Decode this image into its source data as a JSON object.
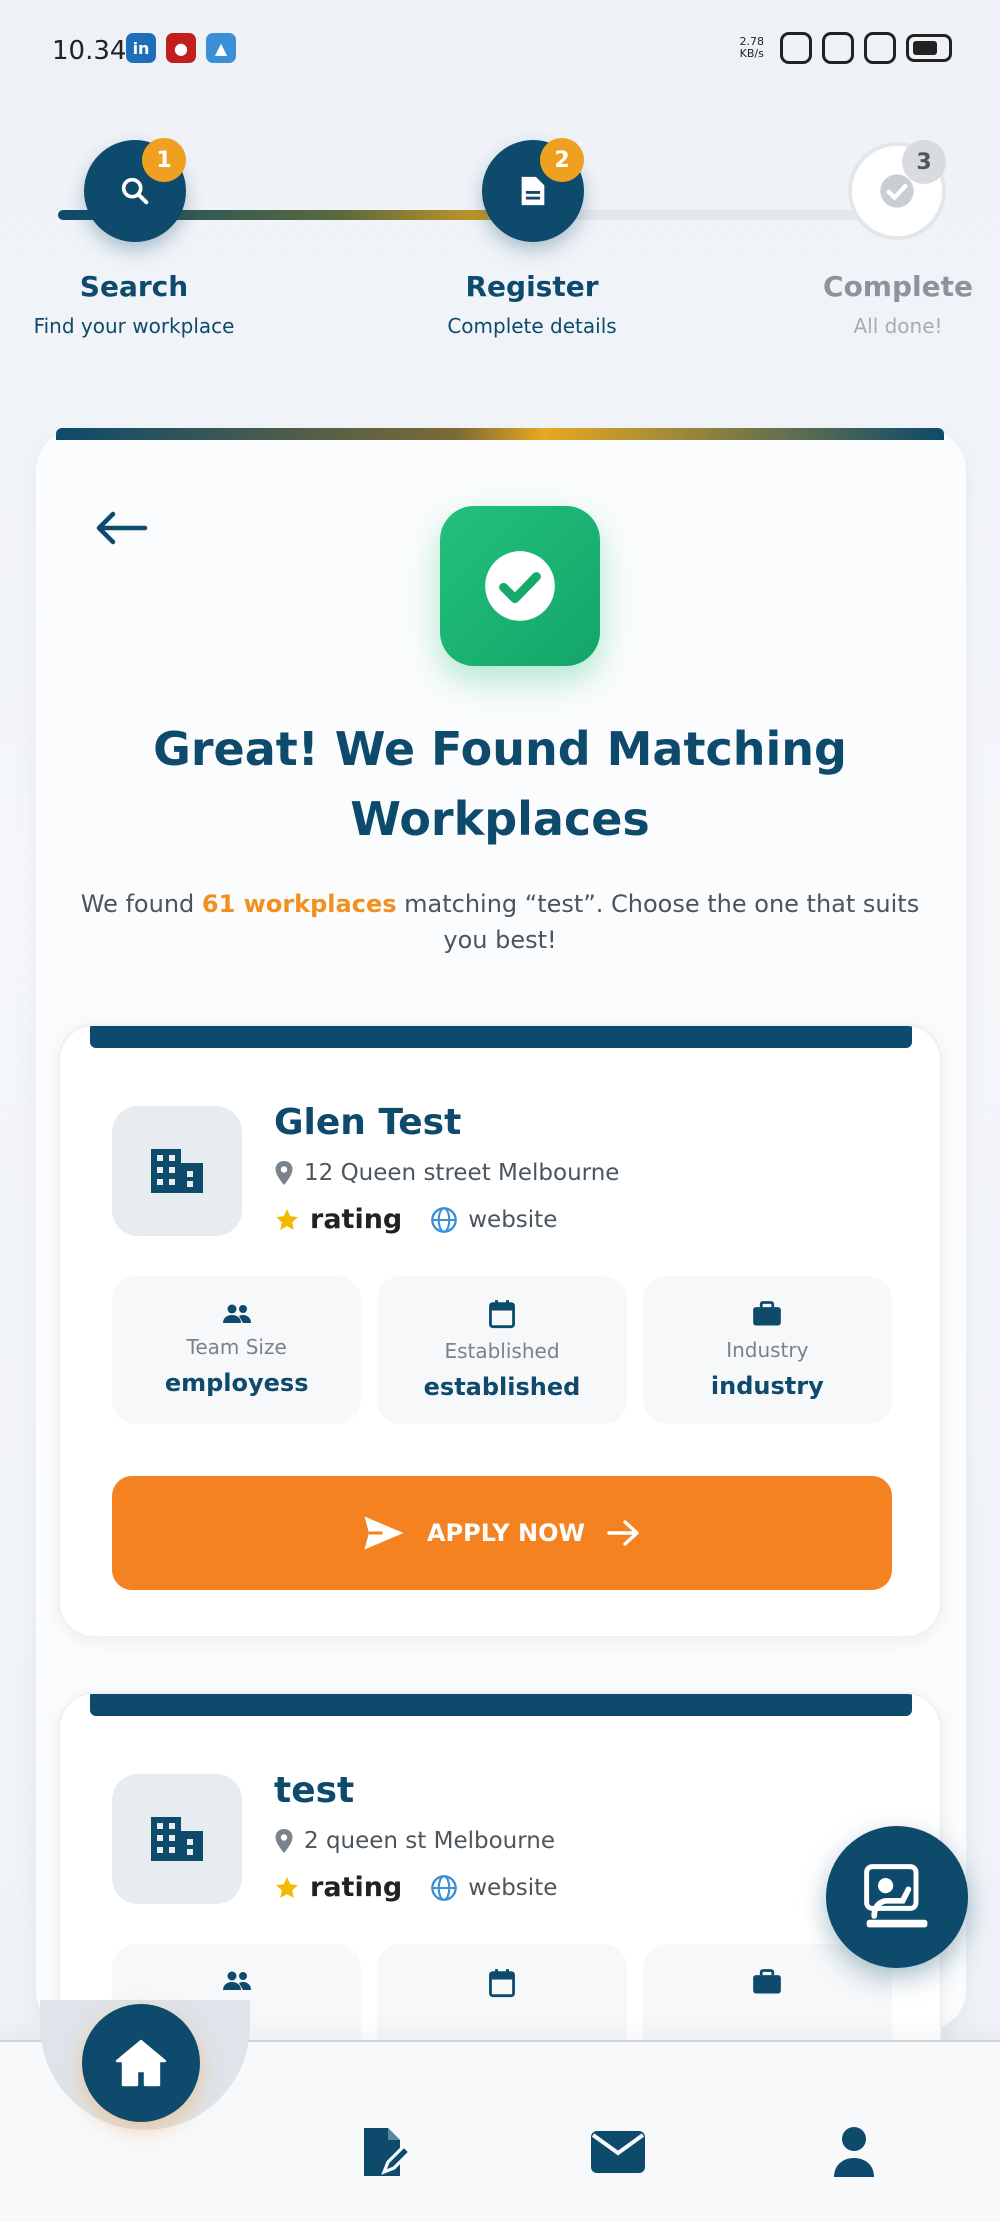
{
  "status_bar": {
    "time": "10.34",
    "net_speed_value": "2.78",
    "net_speed_unit": "KB/s"
  },
  "stepper": {
    "steps": [
      {
        "number": "1",
        "title": "Search",
        "subtitle": "Find your workplace",
        "icon": "search-icon"
      },
      {
        "number": "2",
        "title": "Register",
        "subtitle": "Complete details",
        "icon": "document-icon"
      },
      {
        "number": "3",
        "title": "Complete",
        "subtitle": "All done!",
        "icon": "check-icon"
      }
    ]
  },
  "main": {
    "headline_line1": "Great! We Found Matching",
    "headline_line2": "Workplaces",
    "sub_before": "We found ",
    "sub_count": "61 workplaces",
    "sub_after": " matching “test”. Choose the one that suits you best!"
  },
  "workplaces": [
    {
      "name": "Glen Test",
      "address": "12 Queen street Melbourne",
      "rating_label": "rating",
      "website_label": "website",
      "stats": [
        {
          "label": "Team Size",
          "value": "employess"
        },
        {
          "label": "Established",
          "value": "established"
        },
        {
          "label": "Industry",
          "value": "industry"
        }
      ],
      "apply_label": "APPLY NOW"
    },
    {
      "name": "test",
      "address": "2 queen st Melbourne",
      "rating_label": "rating",
      "website_label": "website"
    }
  ],
  "colors": {
    "primary": "#0d4a6b",
    "accent": "#f58220",
    "success": "#22c17a",
    "badge": "#f0a020",
    "star": "#f5b800"
  }
}
